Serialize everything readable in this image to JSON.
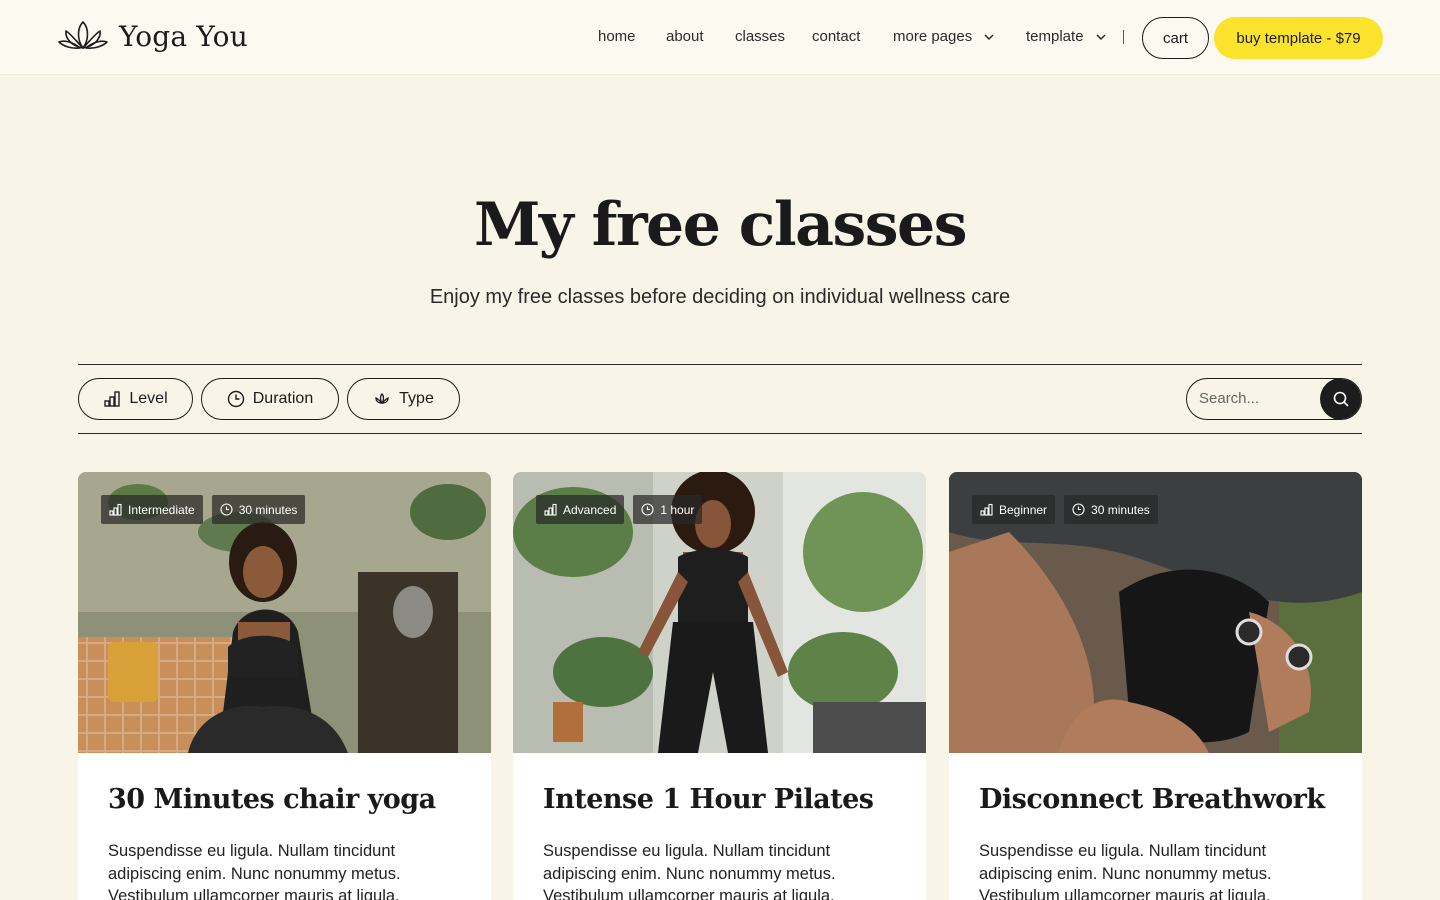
{
  "header": {
    "brand": "Yoga You",
    "nav": [
      "home",
      "about",
      "classes",
      "contact"
    ],
    "dropdowns": [
      "more pages",
      "template"
    ],
    "cart_label": "cart",
    "buy_label": "buy template - $79",
    "accent": "#fbe22c"
  },
  "hero": {
    "title": "My free classes",
    "subtitle": "Enjoy my free classes before deciding on individual wellness care"
  },
  "filters": {
    "level": "Level",
    "duration": "Duration",
    "type": "Type",
    "search_placeholder": "Search..."
  },
  "cards": [
    {
      "level": "Intermediate",
      "duration": "30 minutes",
      "title": "30 Minutes chair yoga",
      "text": "Suspendisse eu ligula. Nullam tincidunt adipiscing enim. Nunc nonummy metus. Vestibulum ullamcorper mauris at ligula."
    },
    {
      "level": "Advanced",
      "duration": "1 hour",
      "title": "Intense 1 Hour Pilates",
      "text": "Suspendisse eu ligula. Nullam tincidunt adipiscing enim. Nunc nonummy metus. Vestibulum ullamcorper mauris at ligula."
    },
    {
      "level": "Beginner",
      "duration": "30 minutes",
      "title": "Disconnect Breathwork",
      "text": "Suspendisse eu ligula. Nullam tincidunt adipiscing enim. Nunc nonummy metus. Vestibulum ullamcorper mauris at ligula."
    }
  ]
}
